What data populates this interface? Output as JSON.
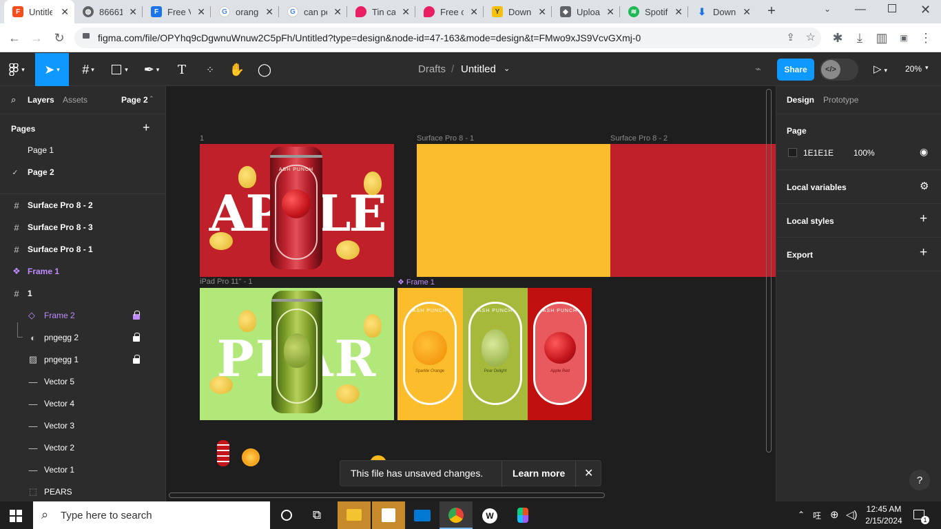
{
  "browser": {
    "tabs": [
      {
        "title": "Untitled",
        "favicon": "figma-icon",
        "color": "#f24e1e"
      },
      {
        "title": "86661",
        "favicon": "globe-icon",
        "color": "#5f6368"
      },
      {
        "title": "Free V",
        "favicon": "forms-icon",
        "color": "#1a73e8"
      },
      {
        "title": "orange",
        "favicon": "google-icon",
        "color": "#4285f4"
      },
      {
        "title": "can pe",
        "favicon": "google-icon",
        "color": "#4285f4"
      },
      {
        "title": "Tin ca",
        "favicon": "drop-icon",
        "color": "#e91e63"
      },
      {
        "title": "Free c",
        "favicon": "drop-icon",
        "color": "#e91e63"
      },
      {
        "title": "Down",
        "favicon": "y-icon",
        "color": "#f4c20d"
      },
      {
        "title": "Uploa",
        "favicon": "cap-icon",
        "color": "#5f6368"
      },
      {
        "title": "Spotif",
        "favicon": "spotify-icon",
        "color": "#1db954"
      },
      {
        "title": "Down",
        "favicon": "download-icon",
        "color": "#1a73e8"
      }
    ],
    "url": "figma.com/file/OPYhq9cDgwnuWnuw2C5pFh/Untitled?type=design&node-id=47-163&mode=design&t=FMwo9xJS9VcvGXmj-0"
  },
  "toolbar": {
    "breadcrumb_drafts": "Drafts",
    "breadcrumb_sep": "/",
    "file_name": "Untitled",
    "share_label": "Share",
    "zoom": "20%"
  },
  "left_panel": {
    "tab_layers": "Layers",
    "tab_assets": "Assets",
    "page_selector": "Page 2",
    "pages_header": "Pages",
    "pages": [
      "Page 1",
      "Page 2"
    ],
    "layers": [
      {
        "name": "Surface Pro 8 - 2",
        "icon": "frame-icon"
      },
      {
        "name": "Surface Pro 8 - 3",
        "icon": "frame-icon"
      },
      {
        "name": "Surface Pro 8 - 1",
        "icon": "frame-icon"
      },
      {
        "name": "Frame 1",
        "icon": "component-icon"
      },
      {
        "name": "1",
        "icon": "frame-icon"
      },
      {
        "name": "Frame 2",
        "icon": "instance-icon"
      },
      {
        "name": "pngegg 2",
        "icon": "mask-icon"
      },
      {
        "name": "pngegg 1",
        "icon": "image-icon"
      },
      {
        "name": "Vector 5",
        "icon": "line-icon"
      },
      {
        "name": "Vector 4",
        "icon": "line-icon"
      },
      {
        "name": "Vector 3",
        "icon": "line-icon"
      },
      {
        "name": "Vector 2",
        "icon": "line-icon"
      },
      {
        "name": "Vector 1",
        "icon": "line-icon"
      },
      {
        "name": "PEARS",
        "icon": "group-icon"
      }
    ]
  },
  "canvas": {
    "frames": {
      "f1": "1",
      "surface1": "Surface Pro 8 - 1",
      "surface2": "Surface Pro 8 - 2",
      "ipad": "iPad Pro 11\" - 1",
      "frame1": "Frame 1"
    },
    "apple_word": "APPLE",
    "pear_word": "PEAR",
    "brand": "ASH PUNCH",
    "can_labels": [
      "Sparkle Orange",
      "Pear Delight",
      "Apple Red"
    ],
    "toast_text": "This file has unsaved changes.",
    "toast_link": "Learn more",
    "colors": {
      "red": "#c0202a",
      "yellow": "#fbbd2b",
      "green": "#b2e879",
      "olive": "#a7b93a"
    }
  },
  "right_panel": {
    "tab_design": "Design",
    "tab_prototype": "Prototype",
    "page_header": "Page",
    "page_color": "1E1E1E",
    "page_opacity": "100%",
    "local_variables": "Local variables",
    "local_styles": "Local styles",
    "export": "Export",
    "help": "?"
  },
  "taskbar": {
    "search_placeholder": "Type here to search",
    "time": "12:45 AM",
    "date": "2/15/2024",
    "notification_count": "1"
  }
}
